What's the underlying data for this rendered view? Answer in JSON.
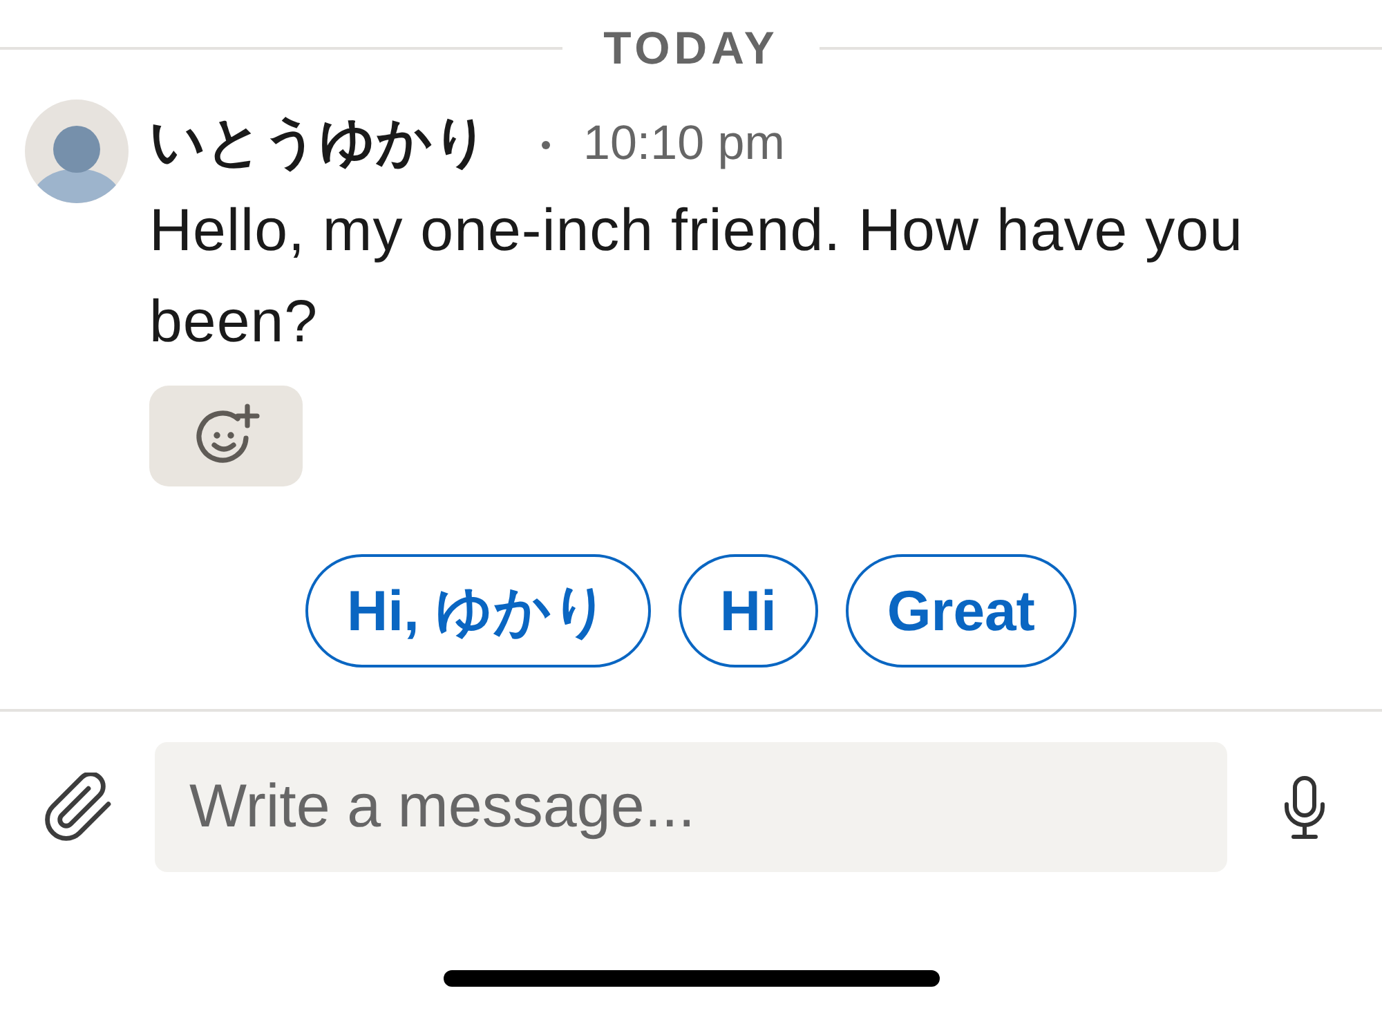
{
  "date_divider": {
    "label": "TODAY"
  },
  "message": {
    "sender": "いとうゆかり",
    "time": "10:10 pm",
    "text": "Hello, my one-inch friend. How have you been?"
  },
  "quick_replies": [
    "Hi, ゆかり",
    "Hi",
    "Great"
  ],
  "composer": {
    "placeholder": "Write a message..."
  }
}
